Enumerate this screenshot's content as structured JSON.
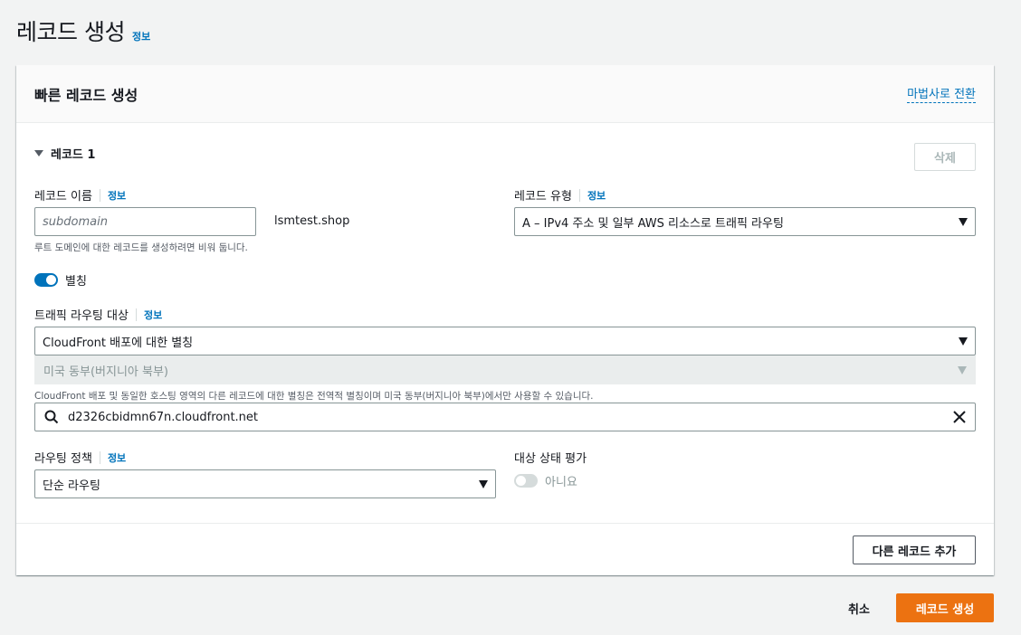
{
  "page": {
    "title": "레코드 생성",
    "info": "정보"
  },
  "panel": {
    "title": "빠른 레코드 생성",
    "wizard_link": "마법사로 전환"
  },
  "record": {
    "heading": "레코드 1",
    "delete_label": "삭제",
    "name": {
      "label": "레코드 이름",
      "info": "정보",
      "placeholder": "subdomain",
      "domain_suffix": "lsmtest.shop",
      "hint": "루트 도메인에 대한 레코드를 생성하려면 비워 둡니다."
    },
    "type": {
      "label": "레코드 유형",
      "info": "정보",
      "value": "A – IPv4 주소 및 일부 AWS 리소스로 트래픽 라우팅"
    },
    "alias": {
      "label": "별칭",
      "enabled": true
    },
    "traffic_target": {
      "label": "트래픽 라우팅 대상",
      "info": "정보",
      "endpoint_type": "CloudFront 배포에 대한 별칭",
      "region": "미국 동부(버지니아 북부)",
      "region_hint": "CloudFront 배포 및 동일한 호스팅 영역의 다른 레코드에 대한 별칭은 전역적 별칭이며 미국 동부(버지니아 북부)에서만 사용할 수 있습니다.",
      "search_value": "d2326cbidmn67n.cloudfront.net"
    },
    "routing_policy": {
      "label": "라우팅 정책",
      "info": "정보",
      "value": "단순 라우팅"
    },
    "health_eval": {
      "label": "대상 상태 평가",
      "value_label": "아니요",
      "enabled": false
    }
  },
  "actions": {
    "add_record": "다른 레코드 추가",
    "cancel": "취소",
    "create": "레코드 생성"
  },
  "colors": {
    "accent": "#0073bb",
    "primary_button": "#ec7211",
    "toggle_on": "#0073bb",
    "toggle_off": "#d5dbdb"
  },
  "icons": {
    "expand": "caret-down-icon",
    "select": "triangle-down-icon",
    "search": "search-icon",
    "clear": "close-icon"
  }
}
